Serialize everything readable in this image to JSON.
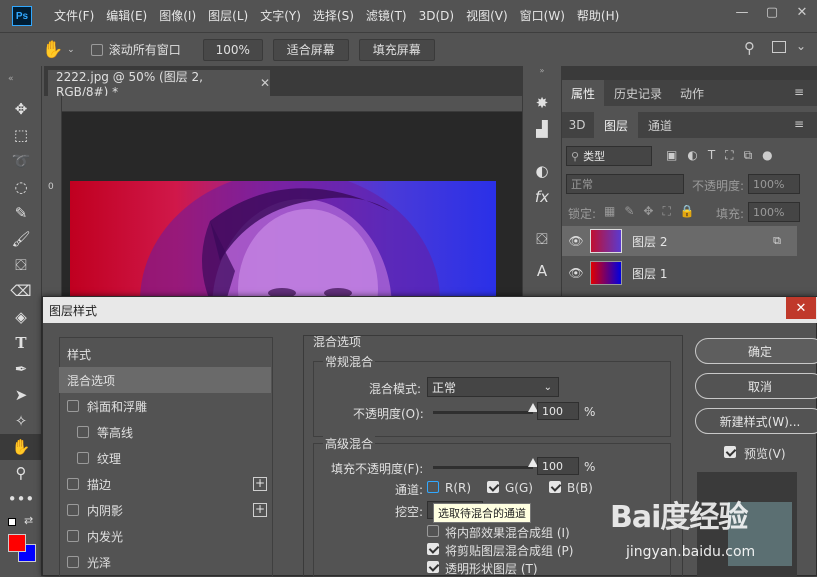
{
  "app": {
    "logo": "Ps"
  },
  "menu": [
    "文件(F)",
    "编辑(E)",
    "图像(I)",
    "图层(L)",
    "文字(Y)",
    "选择(S)",
    "滤镜(T)",
    "3D(D)",
    "视图(V)",
    "窗口(W)",
    "帮助(H)"
  ],
  "options": {
    "scroll_all": "滚动所有窗口",
    "zoom": "100%",
    "fit_screen": "适合屏幕",
    "fill_screen": "填充屏幕"
  },
  "document": {
    "tab_title": "2222.jpg @ 50% (图层 2, RGB/8#) *",
    "ruler_0": "0"
  },
  "panels": {
    "top_tabs": [
      "属性",
      "历史记录",
      "动作"
    ],
    "layer_tabs": [
      "3D",
      "图层",
      "通道"
    ],
    "kind_filter": "类型",
    "blend_mode": "正常",
    "opacity_label": "不透明度:",
    "opacity_value": "100%",
    "lock_label": "锁定:",
    "fill_label": "填充:",
    "fill_value": "100%",
    "layers": [
      {
        "name": "图层 2"
      },
      {
        "name": "图层 1"
      }
    ]
  },
  "dialog": {
    "title": "图层样式",
    "close": "✕",
    "styles": [
      {
        "label": "样式",
        "checkbox": false
      },
      {
        "label": "混合选项",
        "checkbox": false,
        "selected": true
      },
      {
        "label": "斜面和浮雕",
        "checkbox": true
      },
      {
        "label": "等高线",
        "checkbox": true,
        "indent": true
      },
      {
        "label": "纹理",
        "checkbox": true,
        "indent": true
      },
      {
        "label": "描边",
        "checkbox": true,
        "plus": true
      },
      {
        "label": "内阴影",
        "checkbox": true,
        "plus": true
      },
      {
        "label": "内发光",
        "checkbox": true
      },
      {
        "label": "光泽",
        "checkbox": true
      }
    ],
    "blend_options": "混合选项",
    "general_blend": "常规混合",
    "blend_mode_label": "混合模式:",
    "blend_mode_value": "正常",
    "opacity_label": "不透明度(O):",
    "opacity_value": "100",
    "opacity_level": 1.0,
    "percent": "%",
    "advanced_blend": "高级混合",
    "fill_opacity_label": "填充不透明度(F):",
    "fill_opacity_value": "100",
    "fill_opacity_level": 1.0,
    "channels_label": "通道:",
    "ch_r": "R(R)",
    "ch_g": "G(G)",
    "ch_b": "B(B)",
    "knockout_label": "挖空:",
    "tooltip": "选取待混合的通道",
    "opt1": "将内部效果混合成组 (I)",
    "opt2": "将剪贴图层混合成组 (P)",
    "opt3": "透明形状图层 (T)",
    "btn_ok": "确定",
    "btn_cancel": "取消",
    "btn_new_style": "新建样式(W)...",
    "preview": "预览(V)"
  },
  "watermark": {
    "brand": "Bai度经验",
    "url": "jingyan.baidu.com"
  },
  "colors": {
    "foreground": "#ff0000",
    "background": "#0000ff",
    "accent": "#31a8ff"
  }
}
